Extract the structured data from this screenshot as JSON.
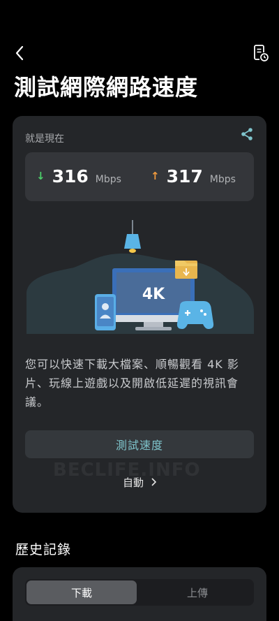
{
  "header": {
    "title": "測試網際網路速度"
  },
  "card": {
    "label": "就是現在",
    "download": {
      "value": "316",
      "unit": "Mbps"
    },
    "upload": {
      "value": "317",
      "unit": "Mbps"
    },
    "illustration": {
      "screen_text": "4K"
    },
    "description": "您可以快速下載大檔案、順暢觀看 4K 影片、玩線上遊戲以及開啟低延遲的視訊會議。",
    "test_button": "測試速度",
    "auto_button": "自動",
    "watermark": "BECLIFE.INFO"
  },
  "history": {
    "title": "歷史記錄",
    "tabs": [
      "下載",
      "上傳"
    ],
    "selected_tab": "下載"
  },
  "colors": {
    "download_arrow": "#4ccf6a",
    "upload_arrow": "#f09a3e",
    "accent_text": "#7fc4cc"
  }
}
